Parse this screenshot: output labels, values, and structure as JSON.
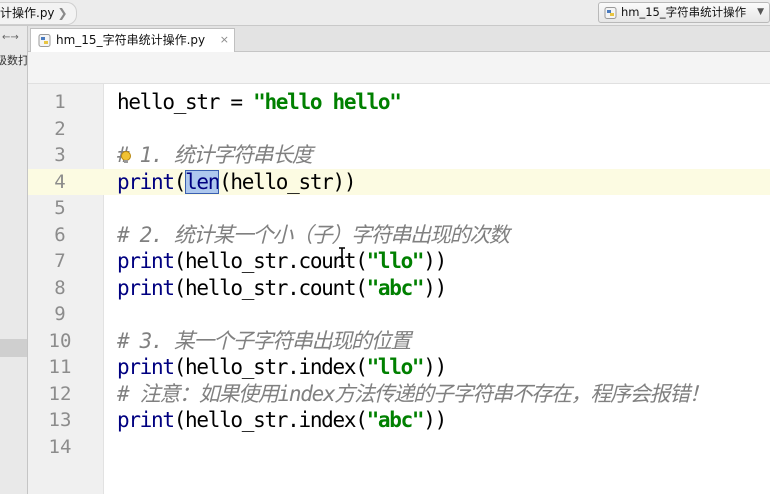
{
  "window": {
    "breadcrumb_file": "计操作.py",
    "run_config_label": "hm_15_字符串统计操作"
  },
  "side_panel": {
    "partial_text": "级数打"
  },
  "editor_tab": {
    "label": "hm_15_字符串统计操作.py",
    "close_glyph": "×"
  },
  "colors": {
    "string": "#008000",
    "comment": "#808080",
    "builtin": "#000080",
    "selection": "#aec8ee",
    "caret_line": "#fcfbe2"
  },
  "icons": [
    "python-file-icon",
    "close-icon",
    "chevron-right-icon",
    "dropdown-arrow-icon",
    "intention-bulb-icon",
    "text-cursor-icon"
  ],
  "code_lines": [
    {
      "n": "1",
      "tokens": [
        {
          "t": "hello_str = ",
          "c": ""
        },
        {
          "t": "\"hello hello\"",
          "c": "str"
        }
      ]
    },
    {
      "n": "2",
      "tokens": []
    },
    {
      "n": "3",
      "tokens": [
        {
          "t": "# 1. 统计字符串长度",
          "c": "cm"
        }
      ]
    },
    {
      "n": "4",
      "tokens": [
        {
          "t": "print",
          "c": "fn"
        },
        {
          "t": "(",
          "c": ""
        },
        {
          "t": "len",
          "c": "fn sel"
        },
        {
          "t": "(hello_str))",
          "c": ""
        }
      ]
    },
    {
      "n": "5",
      "tokens": []
    },
    {
      "n": "6",
      "tokens": [
        {
          "t": "# 2. 统计某一个小（子）字符串出现的次数",
          "c": "cm"
        }
      ]
    },
    {
      "n": "7",
      "tokens": [
        {
          "t": "print",
          "c": "fn"
        },
        {
          "t": "(hello_str.count(",
          "c": ""
        },
        {
          "t": "\"llo\"",
          "c": "str"
        },
        {
          "t": "))",
          "c": ""
        }
      ]
    },
    {
      "n": "8",
      "tokens": [
        {
          "t": "print",
          "c": "fn"
        },
        {
          "t": "(hello_str.count(",
          "c": ""
        },
        {
          "t": "\"abc\"",
          "c": "str"
        },
        {
          "t": "))",
          "c": ""
        }
      ]
    },
    {
      "n": "9",
      "tokens": []
    },
    {
      "n": "10",
      "tokens": [
        {
          "t": "# 3. 某一个子字符串出现的位置",
          "c": "cm"
        }
      ]
    },
    {
      "n": "11",
      "tokens": [
        {
          "t": "print",
          "c": "fn"
        },
        {
          "t": "(hello_str.index(",
          "c": ""
        },
        {
          "t": "\"llo\"",
          "c": "str"
        },
        {
          "t": "))",
          "c": ""
        }
      ]
    },
    {
      "n": "12",
      "tokens": [
        {
          "t": "# 注意：如果使用index方法传递的子字符串不存在，程序会报错！",
          "c": "cm"
        }
      ]
    },
    {
      "n": "13",
      "tokens": [
        {
          "t": "print",
          "c": "fn"
        },
        {
          "t": "(hello_str.index(",
          "c": ""
        },
        {
          "t": "\"abc\"",
          "c": "str"
        },
        {
          "t": "))",
          "c": ""
        }
      ]
    },
    {
      "n": "14",
      "tokens": []
    }
  ]
}
